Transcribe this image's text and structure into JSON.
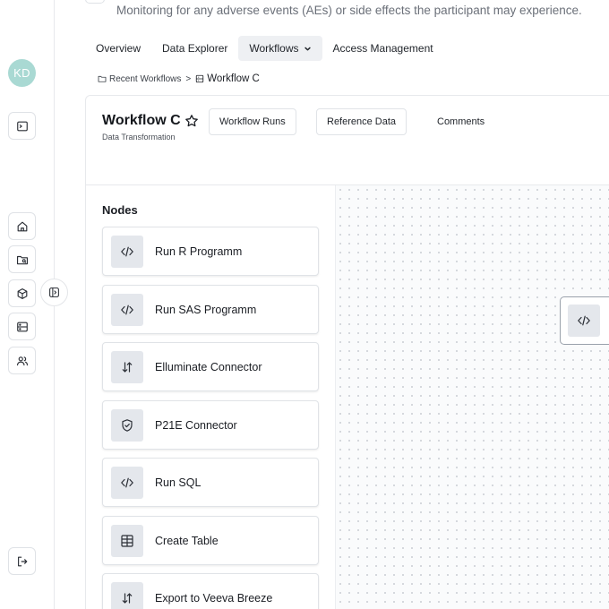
{
  "header": {
    "description": "Monitoring for any adverse events (AEs) or side effects the participant may experience."
  },
  "tabs": [
    {
      "label": "Overview"
    },
    {
      "label": "Data Explorer"
    },
    {
      "label": "Workflows",
      "active": true
    },
    {
      "label": "Access Management"
    }
  ],
  "breadcrumb": {
    "parent": "Recent Workflows",
    "separator": ">",
    "current": "Workflow C"
  },
  "user": {
    "initials": "KD"
  },
  "rail_icons": [
    "terminal-icon",
    "home-icon",
    "folder-search-icon",
    "box-icon",
    "server-icon",
    "users-icon",
    "logout-icon"
  ],
  "workflow": {
    "title": "Workflow C",
    "subtitle": "Data Transformation",
    "buttons": {
      "runs": "Workflow Runs",
      "reference": "Reference Data",
      "comments": "Comments"
    }
  },
  "nodes": {
    "title": "Nodes",
    "items": [
      {
        "label": "Run R Programm",
        "icon": "code-icon"
      },
      {
        "label": "Run SAS Programm",
        "icon": "code-icon"
      },
      {
        "label": "Elluminate Connector",
        "icon": "arrows-up-down-icon"
      },
      {
        "label": "P21E Connector",
        "icon": "shield-check-icon"
      },
      {
        "label": "Run SQL",
        "icon": "code-icon"
      },
      {
        "label": "Create Table",
        "icon": "table-icon"
      },
      {
        "label": "Export to Veeva Breeze",
        "icon": "arrows-up-down-icon"
      }
    ]
  },
  "canvas": {
    "nodes": [
      {
        "icon": "code-icon"
      }
    ]
  },
  "colors": {
    "avatar_bg": "#a9d9d3",
    "icon_tile_bg": "#e4e7ec",
    "active_tab_bg": "#eef0f3",
    "border": "#e0e3e7"
  }
}
